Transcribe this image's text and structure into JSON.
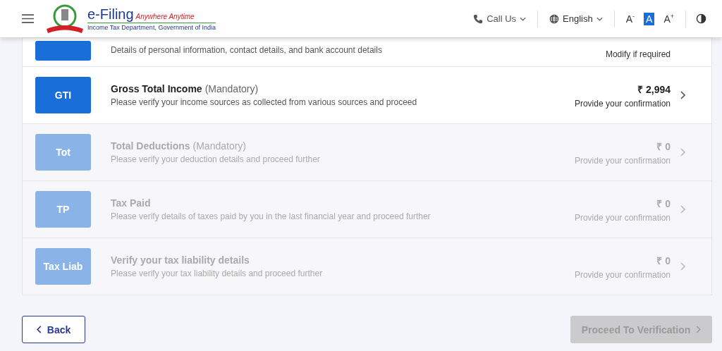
{
  "header": {
    "brand": "e-Filing",
    "tagline": "Anywhere Anytime",
    "department": "Income Tax Department, Government of India",
    "call_us": "Call Us",
    "language": "English",
    "font_sizes": [
      {
        "label": "A",
        "mark": "-",
        "selected": false
      },
      {
        "label": "A",
        "selected": true
      },
      {
        "label": "A",
        "mark": "+",
        "selected": false
      }
    ]
  },
  "sections": [
    {
      "description": "Details of personal information, contact details, and bank account details",
      "status": "Modify if required",
      "disabled": false
    },
    {
      "badge": "GTI",
      "title": "Gross Total Income",
      "mandatory": "(Mandatory)",
      "description": "Please verify your income sources as collected from various sources and proceed",
      "amount": "₹ 2,994",
      "status": "Provide your confirmation",
      "disabled": false
    },
    {
      "badge": "Tot",
      "title": "Total Deductions",
      "mandatory": "(Mandatory)",
      "description": "Please verify your deduction details and proceed further",
      "amount": "₹ 0",
      "status": "Provide your confirmation",
      "disabled": true
    },
    {
      "badge": "TP",
      "title": "Tax Paid",
      "description": "Please verify details of taxes paid by you in the last financial year and proceed further",
      "amount": "₹ 0",
      "status": "Provide your confirmation",
      "disabled": true
    },
    {
      "badge": "Tax Liab",
      "title": "Verify your tax liability details",
      "description": "Please verify your tax liability details and proceed further",
      "amount": "₹ 0",
      "status": "Provide your confirmation",
      "disabled": true
    }
  ],
  "footer": {
    "back": "Back",
    "proceed": "Proceed To Verification",
    "proceed_disabled": true
  }
}
